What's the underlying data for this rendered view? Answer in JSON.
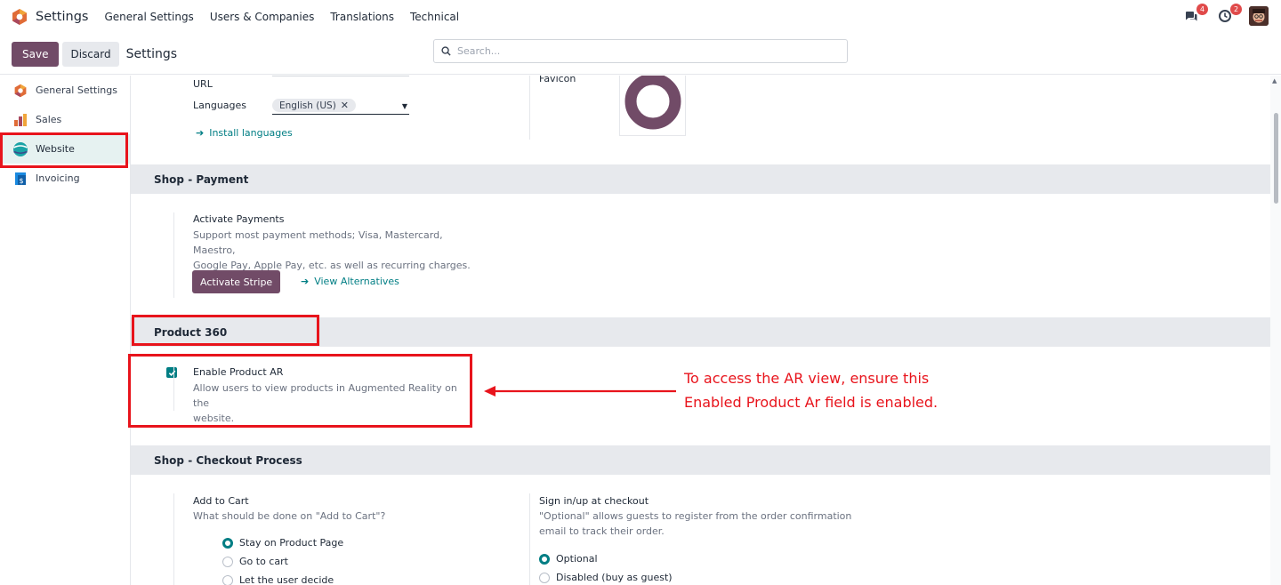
{
  "topbar": {
    "app_name": "Settings",
    "nav": [
      "General Settings",
      "Users & Companies",
      "Translations",
      "Technical"
    ],
    "messages_count": "4",
    "activities_count": "2"
  },
  "control": {
    "save_label": "Save",
    "discard_label": "Discard",
    "title": "Settings",
    "search_placeholder": "Search..."
  },
  "sidebar": {
    "items": [
      {
        "label": "General Settings",
        "icon": "odoo-logo-icon"
      },
      {
        "label": "Sales",
        "icon": "sales-chart-icon"
      },
      {
        "label": "Website",
        "icon": "website-globe-icon"
      },
      {
        "label": "Invoicing",
        "icon": "invoice-icon"
      }
    ]
  },
  "website_info": {
    "url_label": "URL",
    "languages_label": "Languages",
    "language_tag": "English (US)",
    "install_languages": "Install languages",
    "favicon_label": "Favicon"
  },
  "shop_payment": {
    "header": "Shop - Payment",
    "title": "Activate Payments",
    "desc_line1": "Support most payment methods; Visa, Mastercard, Maestro,",
    "desc_line2": "Google Pay, Apple Pay, etc. as well as recurring charges.",
    "stripe_button": "Activate Stripe",
    "alternatives_link": "View Alternatives"
  },
  "product360": {
    "header": "Product 360",
    "title": "Enable Product AR",
    "desc_line1": "Allow users to view products in Augmented Reality on the",
    "desc_line2": "website.",
    "checked": true
  },
  "annotation": {
    "line1": "To access the AR view, ensure this",
    "line2": "Enabled Product Ar field is enabled."
  },
  "checkout": {
    "header": "Shop - Checkout Process",
    "add_to_cart_title": "Add to Cart",
    "add_to_cart_desc": "What should be done on \"Add to Cart\"?",
    "add_to_cart_options": [
      "Stay on Product Page",
      "Go to cart",
      "Let the user decide"
    ],
    "signin_title": "Sign in/up at checkout",
    "signin_desc_line1": "\"Optional\" allows guests to register from the order confirmation",
    "signin_desc_line2": "email to track their order.",
    "signin_options": [
      "Optional",
      "Disabled (buy as guest)"
    ]
  },
  "colors": {
    "brand": "#714b67",
    "accent": "#017e84",
    "annotation": "#e8141c",
    "section_bg": "#e7e9ed"
  }
}
